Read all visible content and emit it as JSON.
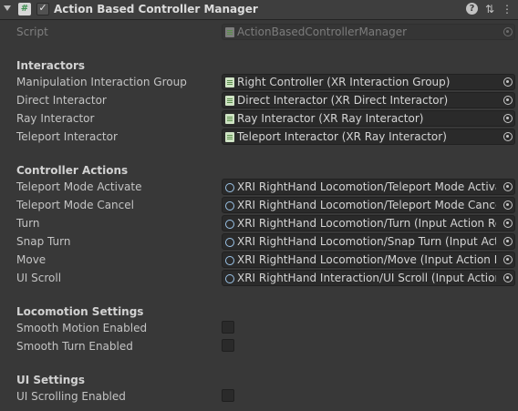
{
  "header": {
    "title": "Action Based Controller Manager",
    "script_icon_glyph": "#",
    "enabled_glyph": "✓",
    "icons": [
      "help-icon",
      "preset-icon",
      "context-menu-icon"
    ]
  },
  "script": {
    "label": "Script",
    "value": "ActionBasedControllerManager"
  },
  "interactors": {
    "header": "Interactors",
    "rows": [
      {
        "label": "Manipulation Interaction Group",
        "value": "Right Controller (XR Interaction Group)"
      },
      {
        "label": "Direct Interactor",
        "value": "Direct Interactor (XR Direct Interactor)"
      },
      {
        "label": "Ray Interactor",
        "value": "Ray Interactor (XR Ray Interactor)"
      },
      {
        "label": "Teleport Interactor",
        "value": "Teleport Interactor (XR Ray Interactor)"
      }
    ]
  },
  "controller_actions": {
    "header": "Controller Actions",
    "rows": [
      {
        "label": "Teleport Mode Activate",
        "value": "XRI RightHand Locomotion/Teleport Mode Activate"
      },
      {
        "label": "Teleport Mode Cancel",
        "value": "XRI RightHand Locomotion/Teleport Mode Cancel (I"
      },
      {
        "label": "Turn",
        "value": "XRI RightHand Locomotion/Turn (Input Action Refere"
      },
      {
        "label": "Snap Turn",
        "value": "XRI RightHand Locomotion/Snap Turn (Input Action"
      },
      {
        "label": "Move",
        "value": "XRI RightHand Locomotion/Move (Input Action Refe"
      },
      {
        "label": "UI Scroll",
        "value": "XRI RightHand Interaction/UI Scroll (Input Action Ref"
      }
    ]
  },
  "locomotion_settings": {
    "header": "Locomotion Settings",
    "rows": [
      {
        "label": "Smooth Motion Enabled",
        "checked": false
      },
      {
        "label": "Smooth Turn Enabled",
        "checked": false
      }
    ]
  },
  "ui_settings": {
    "header": "UI Settings",
    "rows": [
      {
        "label": "UI Scrolling Enabled",
        "checked": false
      }
    ]
  },
  "colors": {
    "background": "#383838",
    "field": "#2a2a2a",
    "text": "#c4c4c4"
  }
}
